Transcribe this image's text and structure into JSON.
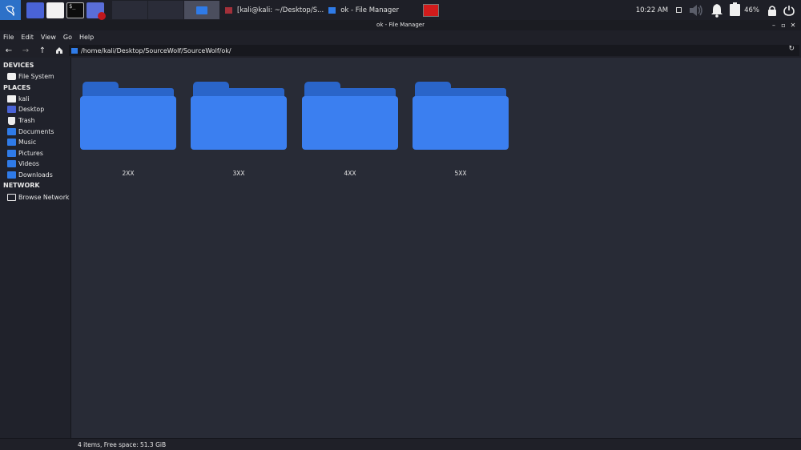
{
  "taskbar": {
    "tasks": [
      {
        "label": "[kali@kali: ~/Desktop/S..."
      },
      {
        "label": "ok - File Manager"
      }
    ],
    "clock": "10:22 AM",
    "battery_percent": "46%"
  },
  "window": {
    "title": "ok - File Manager",
    "controls": [
      "–",
      "▫",
      "✕"
    ]
  },
  "menubar": [
    "File",
    "Edit",
    "View",
    "Go",
    "Help"
  ],
  "toolbar": {
    "path": "/home/kali/Desktop/SourceWolf/SourceWolf/ok/"
  },
  "sidebar": {
    "devices_header": "DEVICES",
    "devices": [
      {
        "label": "File System"
      }
    ],
    "places_header": "PLACES",
    "places": [
      {
        "label": "kali"
      },
      {
        "label": "Desktop"
      },
      {
        "label": "Trash"
      },
      {
        "label": "Documents"
      },
      {
        "label": "Music"
      },
      {
        "label": "Pictures"
      },
      {
        "label": "Videos"
      },
      {
        "label": "Downloads"
      }
    ],
    "network_header": "NETWORK",
    "network": [
      {
        "label": "Browse Network"
      }
    ]
  },
  "files": [
    {
      "name": "2XX"
    },
    {
      "name": "3XX"
    },
    {
      "name": "4XX"
    },
    {
      "name": "5XX"
    }
  ],
  "status": "4 items, Free space: 51.3 GiB",
  "colors": {
    "accent": "#3b7ff0",
    "background": "#282b36",
    "sidebar": "#20222b"
  }
}
